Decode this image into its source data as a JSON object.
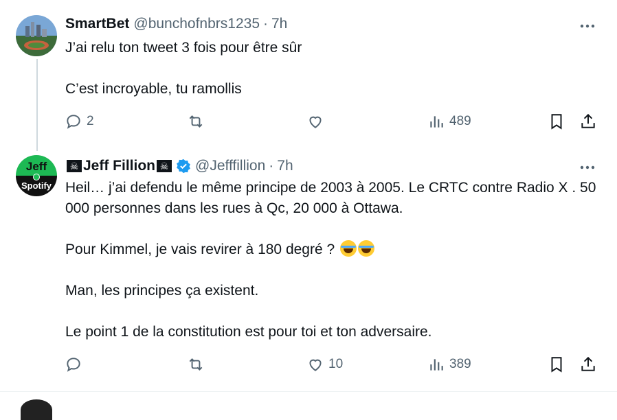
{
  "tweets": [
    {
      "author_name": "SmartBet",
      "handle": "@bunchofnbrs1235",
      "dot": "·",
      "time": "7h",
      "lines": [
        "J’ai relu ton tweet 3 fois pour être sûr",
        "",
        "C’est incroyable, tu ramollis"
      ],
      "stats": {
        "replies": "2",
        "retweets": "",
        "likes": "",
        "views": "489"
      }
    },
    {
      "author_name": "Jeff Fillion",
      "handle": "@Jefffillion",
      "dot": "·",
      "time": "7h",
      "avatar_text_top": "Jeff",
      "avatar_text_bottom": "Spotify",
      "lines": [
        "Heil… j’ai defendu le même principe de 2003 à 2005. Le CRTC contre Radio X . 50 000 personnes dans les rues à Qc, 20 000 à Ottawa.",
        "",
        "Pour Kimmel, je vais revirer à 180 degré ?",
        "",
        "Man, les principes ça existent.",
        "",
        "Le point 1 de la constitution est pour toi et ton adversaire."
      ],
      "stats": {
        "replies": "",
        "retweets": "",
        "likes": "10",
        "views": "389"
      }
    }
  ],
  "icons": {
    "reply": "reply-icon",
    "retweet": "retweet-icon",
    "like": "heart-icon",
    "views": "views-icon",
    "bookmark": "bookmark-icon",
    "share": "share-icon",
    "more": "more-icon",
    "verified": "verified-badge-icon",
    "skull": "skull-crossbones-icon",
    "emoji": "joy-emoji-icon"
  },
  "colors": {
    "text": "#0f1419",
    "secondary": "#536471",
    "verified": "#1d9bf0",
    "thread_line": "#cfd9de"
  }
}
